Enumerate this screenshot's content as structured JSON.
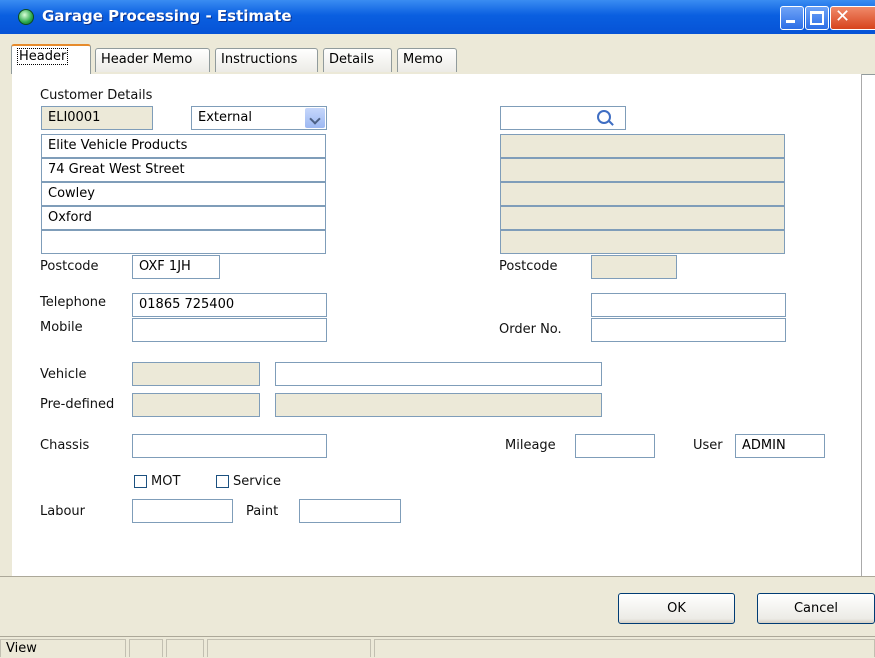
{
  "window": {
    "title": "Garage Processing - Estimate"
  },
  "tabs": [
    {
      "label": "Header",
      "active": true
    },
    {
      "label": "Header Memo",
      "active": false
    },
    {
      "label": "Instructions",
      "active": false
    },
    {
      "label": "Details",
      "active": false
    },
    {
      "label": "Memo",
      "active": false
    }
  ],
  "customer": {
    "section_label": "Customer Details",
    "code": "ELI0001",
    "type_selected": "External",
    "address_lines": [
      "Elite Vehicle Products",
      "74 Great West Street",
      "Cowley",
      "Oxford",
      ""
    ],
    "postcode_label": "Postcode",
    "postcode": "OXF 1JH",
    "telephone_label": "Telephone",
    "telephone": "01865 725400",
    "mobile_label": "Mobile",
    "mobile": ""
  },
  "delivery": {
    "search_value": "",
    "address_lines": [
      "",
      "",
      "",
      "",
      ""
    ],
    "postcode_label": "Postcode",
    "postcode": "",
    "telephone": "",
    "order_label": "Order No.",
    "order_no": ""
  },
  "vehicle": {
    "vehicle_label": "Vehicle",
    "vehicle_code": "",
    "vehicle_desc": "",
    "predefined_label": "Pre-defined",
    "predefined_code": "",
    "predefined_desc": "",
    "chassis_label": "Chassis",
    "chassis": "",
    "mileage_label": "Mileage",
    "mileage": "",
    "user_label": "User",
    "user": "ADMIN",
    "mot_label": "MOT",
    "mot_checked": false,
    "service_label": "Service",
    "service_checked": false,
    "labour_label": "Labour",
    "labour": "",
    "paint_label": "Paint",
    "paint": ""
  },
  "buttons": {
    "ok": "OK",
    "cancel": "Cancel"
  },
  "status": {
    "mode": "View"
  },
  "colors": {
    "title_bar": "#0653d6",
    "dialog_bg": "#ece9d8",
    "field_border": "#7f9db9",
    "active_tab_accent": "#e68b2c"
  }
}
